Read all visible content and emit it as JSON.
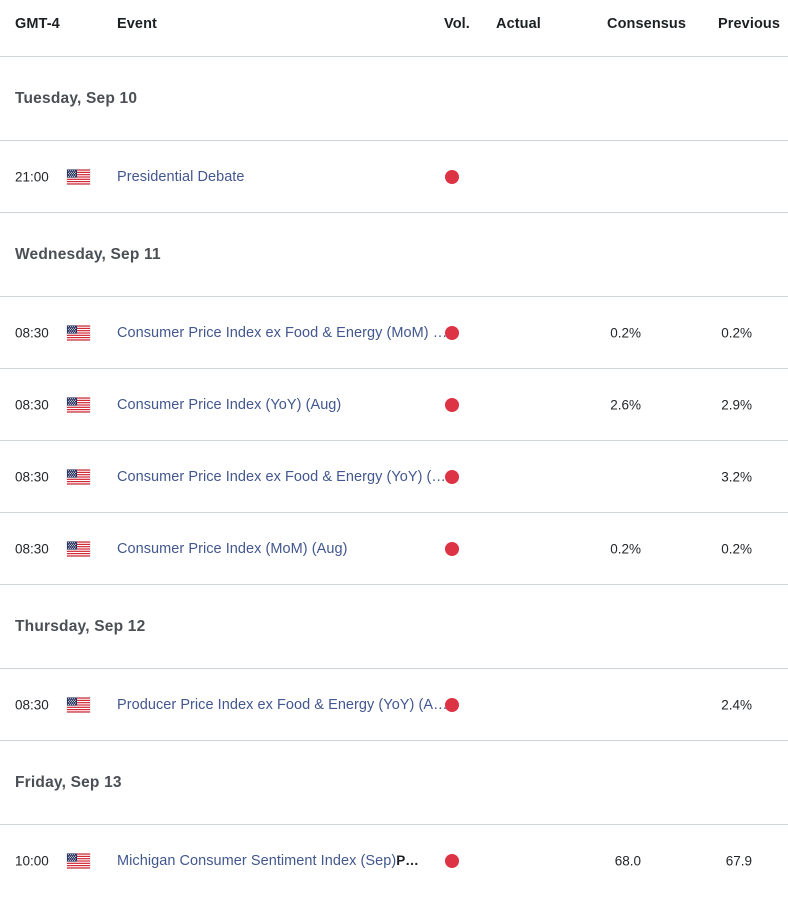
{
  "header": {
    "timezone_label": "GMT-4",
    "event_label": "Event",
    "volatility_label": "Vol.",
    "actual_label": "Actual",
    "consensus_label": "Consensus",
    "previous_label": "Previous"
  },
  "colors": {
    "event_link": "#42578f",
    "volatility_high": "#dc3445",
    "divider": "#cfd4d8",
    "day_heading": "#4a4f55",
    "text": "#23262a"
  },
  "icons": {
    "flag": "us-flag-icon",
    "volatility": "volatility-dot-icon"
  },
  "days": [
    {
      "date_label": "Tuesday, Sep 10",
      "events": [
        {
          "time": "21:00",
          "country": "United States",
          "flag": "us-flag-icon",
          "name": "Presidential Debate",
          "name_suffix": "",
          "volatility": "high",
          "actual": "",
          "consensus": "",
          "previous": ""
        }
      ]
    },
    {
      "date_label": "Wednesday, Sep 11",
      "events": [
        {
          "time": "08:30",
          "country": "United States",
          "flag": "us-flag-icon",
          "name": "Consumer Price Index ex Food & Energy (MoM) (Aug)",
          "name_suffix": "",
          "volatility": "high",
          "actual": "",
          "consensus": "0.2%",
          "previous": "0.2%"
        },
        {
          "time": "08:30",
          "country": "United States",
          "flag": "us-flag-icon",
          "name": "Consumer Price Index (YoY) (Aug)",
          "name_suffix": "",
          "volatility": "high",
          "actual": "",
          "consensus": "2.6%",
          "previous": "2.9%"
        },
        {
          "time": "08:30",
          "country": "United States",
          "flag": "us-flag-icon",
          "name": "Consumer Price Index ex Food & Energy (YoY) (Aug)",
          "name_suffix": "",
          "volatility": "high",
          "actual": "",
          "consensus": "",
          "previous": "3.2%"
        },
        {
          "time": "08:30",
          "country": "United States",
          "flag": "us-flag-icon",
          "name": "Consumer Price Index (MoM) (Aug)",
          "name_suffix": "",
          "volatility": "high",
          "actual": "",
          "consensus": "0.2%",
          "previous": "0.2%"
        }
      ]
    },
    {
      "date_label": "Thursday, Sep 12",
      "events": [
        {
          "time": "08:30",
          "country": "United States",
          "flag": "us-flag-icon",
          "name": "Producer Price Index ex Food & Energy (YoY) (Aug)",
          "name_suffix": "",
          "volatility": "high",
          "actual": "",
          "consensus": "",
          "previous": "2.4%"
        }
      ]
    },
    {
      "date_label": "Friday, Sep 13",
      "events": [
        {
          "time": "10:00",
          "country": "United States",
          "flag": "us-flag-icon",
          "name": "Michigan Consumer Sentiment Index (Sep)",
          "name_suffix": "Prel",
          "volatility": "high",
          "actual": "",
          "consensus": "68.0",
          "previous": "67.9"
        }
      ]
    }
  ]
}
